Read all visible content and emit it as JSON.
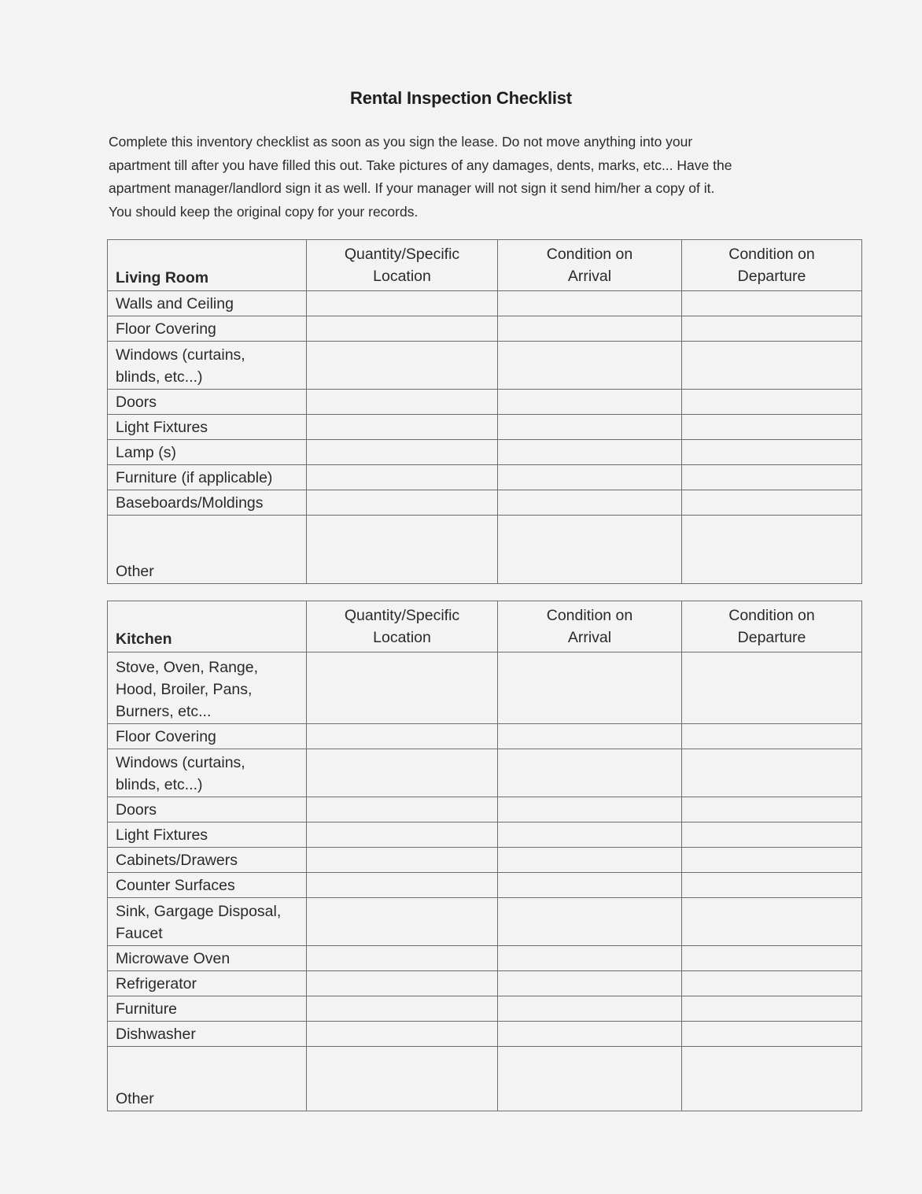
{
  "document": {
    "title": "Rental Inspection Checklist",
    "intro_lines": [
      "Complete this inventory checklist as soon as you sign the lease.  Do not move anything into your",
      "apartment till after you have filled this out.  Take pictures of any damages, dents, marks, etc... Have the",
      "apartment manager/landlord sign it as well.   If your manager will not sign it send him/her a copy of it.",
      "You should keep the original copy for your records."
    ]
  },
  "columns": {
    "quantity": [
      "Quantity/Specific",
      "Location"
    ],
    "arrival": [
      "Condition on",
      "Arrival"
    ],
    "departure": [
      "Condition on",
      "Departure"
    ]
  },
  "sections": {
    "living_room": {
      "heading": "Living Room",
      "items": [
        {
          "lines": [
            "Walls and Ceiling"
          ]
        },
        {
          "lines": [
            "Floor Covering"
          ]
        },
        {
          "lines": [
            "Windows (curtains,",
            "blinds, etc...)"
          ]
        },
        {
          "lines": [
            "Doors"
          ]
        },
        {
          "lines": [
            "Light Fixtures"
          ]
        },
        {
          "lines": [
            "Lamp (s)"
          ]
        },
        {
          "lines": [
            "Furniture (if applicable)"
          ]
        },
        {
          "lines": [
            "Baseboards/Moldings"
          ]
        },
        {
          "lines": [
            "Other"
          ]
        }
      ]
    },
    "kitchen": {
      "heading": "Kitchen",
      "items": [
        {
          "lines": [
            "Stove, Oven, Range,",
            "Hood, Broiler, Pans,",
            "Burners, etc..."
          ]
        },
        {
          "lines": [
            "Floor Covering"
          ]
        },
        {
          "lines": [
            "Windows (curtains,",
            "blinds, etc...)"
          ]
        },
        {
          "lines": [
            "Doors"
          ]
        },
        {
          "lines": [
            "Light Fixtures"
          ]
        },
        {
          "lines": [
            "Cabinets/Drawers"
          ]
        },
        {
          "lines": [
            "Counter Surfaces"
          ]
        },
        {
          "lines": [
            "Sink, Gargage Disposal,",
            "Faucet"
          ]
        },
        {
          "lines": [
            "Microwave Oven"
          ]
        },
        {
          "lines": [
            "Refrigerator"
          ]
        },
        {
          "lines": [
            "Furniture"
          ]
        },
        {
          "lines": [
            "Dishwasher"
          ]
        },
        {
          "lines": [
            "Other"
          ]
        }
      ]
    }
  }
}
